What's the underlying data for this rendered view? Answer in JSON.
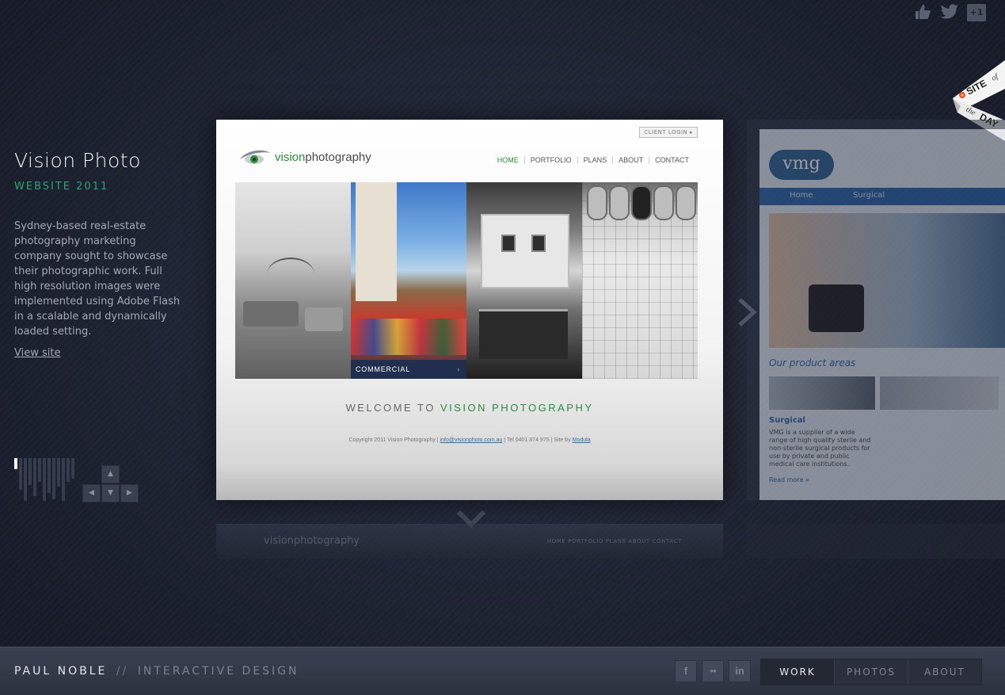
{
  "social_top": {
    "like_icon": "thumbs-up-icon",
    "twitter_icon": "twitter-bird-icon",
    "gplus_label": "+1"
  },
  "badge": {
    "line1": "SITE",
    "of": "of",
    "the": "the",
    "line2": "DAY"
  },
  "project": {
    "title": "Vision Photo",
    "subtitle": "WEBSITE 2011",
    "description": "Sydney-based real-estate photography marketing company sought to showcase their photographic work. Full high resolution images were implemented using Adobe Flash in a scalable and dynamically loaded setting.",
    "view_site": "View site"
  },
  "keys": {
    "up": "▲",
    "left": "◀",
    "down": "▼",
    "right": "▶"
  },
  "screenshot": {
    "client_login": "CLIENT LOGIN ▸",
    "logo_prefix": "vision",
    "logo_suffix": "photography",
    "nav": [
      "HOME",
      "PORTFOLIO",
      "PLANS",
      "ABOUT",
      "CONTACT"
    ],
    "panel_caption": "COMMERCIAL",
    "welcome_prefix": "WELCOME TO ",
    "welcome_brand": "VISION PHOTOGRAPHY",
    "footer_copy": "Copyright 2011 Vision Photography  |  ",
    "footer_email": "info@visionphoto.com.au",
    "footer_tel": "  |  Tel 0401 874 975  |  Site by ",
    "footer_credit": "Modula"
  },
  "next_preview": {
    "logo": "vmg",
    "nav": [
      "Home",
      "Surgical"
    ],
    "heading": "Our product areas",
    "section": "Surgical",
    "text": "VMG is a supplier of a wide range of high quality sterile and non-sterile surgical products for use by private and public medical care institutions.",
    "more": "Read more »"
  },
  "below_preview": {
    "logo": "visionphotography",
    "nav": "HOME   PORTFOLIO   PLANS   ABOUT   CONTACT"
  },
  "footer": {
    "name": "PAUL NOBLE",
    "separator": "//",
    "tagline": "INTERACTIVE DESIGN",
    "social": [
      "f",
      "●●",
      "in"
    ],
    "tabs": [
      "WORK",
      "PHOTOS",
      "ABOUT"
    ]
  }
}
